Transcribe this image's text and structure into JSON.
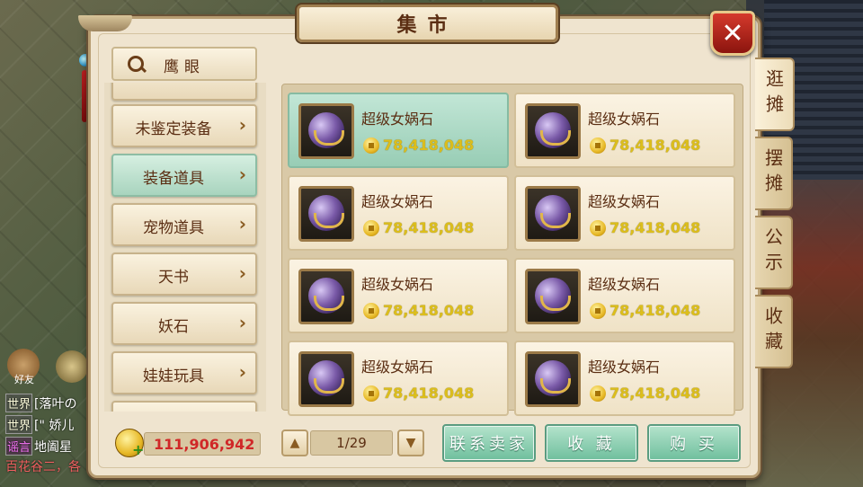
{
  "window": {
    "title": "集市",
    "close_label": "✕"
  },
  "search": {
    "label": "鹰眼"
  },
  "categories": [
    {
      "label": "未鉴定装备",
      "arrow": "›",
      "active": false
    },
    {
      "label": "装备道具",
      "arrow": "›",
      "active": true
    },
    {
      "label": "宠物道具",
      "arrow": "›",
      "active": false
    },
    {
      "label": "天书",
      "arrow": "›",
      "active": false
    },
    {
      "label": "妖石",
      "arrow": "›",
      "active": false
    },
    {
      "label": "娃娃玩具",
      "arrow": "›",
      "active": false
    }
  ],
  "items": [
    {
      "name": "超级女娲石",
      "price": "78,418,048",
      "active": true
    },
    {
      "name": "超级女娲石",
      "price": "78,418,048",
      "active": false
    },
    {
      "name": "超级女娲石",
      "price": "78,418,048",
      "active": false
    },
    {
      "name": "超级女娲石",
      "price": "78,418,048",
      "active": false
    },
    {
      "name": "超级女娲石",
      "price": "78,418,048",
      "active": false
    },
    {
      "name": "超级女娲石",
      "price": "78,418,048",
      "active": false
    },
    {
      "name": "超级女娲石",
      "price": "78,418,048",
      "active": false
    },
    {
      "name": "超级女娲石",
      "price": "78,418,048",
      "active": false
    }
  ],
  "tabs": [
    {
      "label": "逛摊",
      "active": true
    },
    {
      "label": "摆摊",
      "active": false
    },
    {
      "label": "公示",
      "active": false
    },
    {
      "label": "收藏",
      "active": false
    }
  ],
  "footer": {
    "money": "111,906,942",
    "money_plus": "+",
    "page": "1/29",
    "prev_label": "▲",
    "next_label": "▼",
    "contact_label": "联系卖家",
    "favorite_label": "收 藏",
    "buy_label": "购 买"
  },
  "chat": {
    "friend_label": "好友",
    "lines": [
      {
        "tag": "世界",
        "text": "[落叶の"
      },
      {
        "tag": "世界",
        "text": "[\" 娇儿"
      },
      {
        "tag": "谣言",
        "text": "地阖星"
      },
      {
        "tag": "",
        "text": "百花谷二，各"
      }
    ]
  },
  "colors": {
    "accent_green": "#6fbf9d",
    "price_gold": "#dcbe1c",
    "money_red": "#d02828",
    "close_red": "#d53a2c"
  }
}
